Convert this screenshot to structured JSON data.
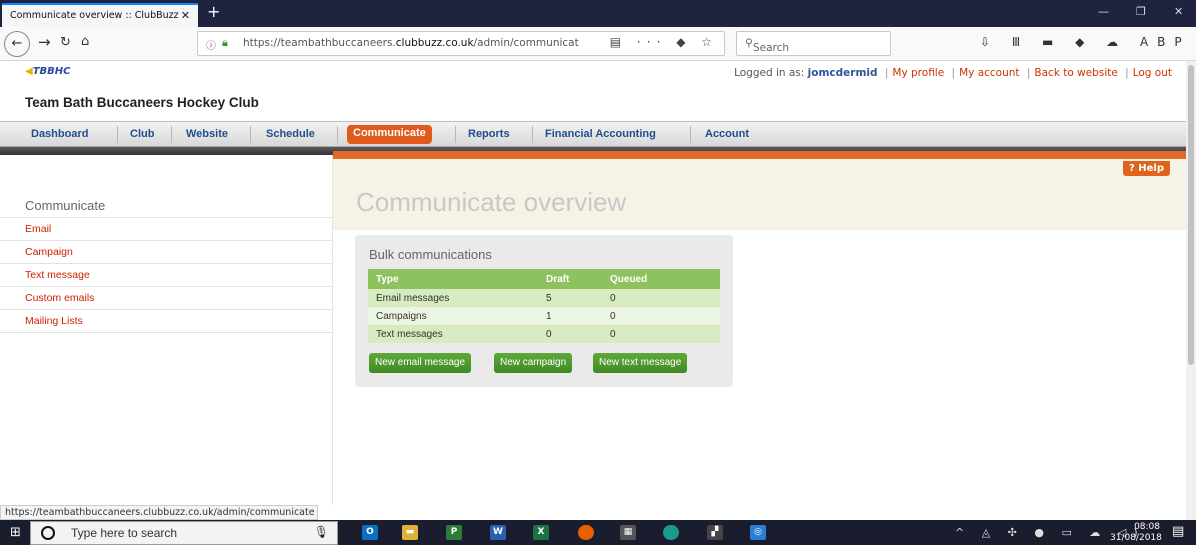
{
  "browser": {
    "tab_title": "Communicate overview :: ClubBuzz",
    "tab_close": "✕",
    "new_tab": "+",
    "url_prefix": "https://teambathbuccaneers.",
    "url_domain": "clubbuzz.co.uk",
    "url_suffix": "/admin/communicat",
    "search_placeholder": "Search",
    "url_actions": "▤ ··· ◆ ☆",
    "toolbar_icons": "⇩ Ⅲ ▬ ◆ ☁ ABP ▭ ≡"
  },
  "header": {
    "logo_text": "TBBHC",
    "logged_in_label": "Logged in as:",
    "username": "jomcdermid",
    "links": [
      "My profile",
      "My account",
      "Back to website",
      "Log out"
    ],
    "club_name": "Team Bath Buccaneers Hockey Club"
  },
  "main_nav": [
    "Dashboard",
    "Club",
    "Website",
    "Schedule",
    "Communicate",
    "Reports",
    "Financial Accounting",
    "Account"
  ],
  "sidebar": {
    "title": "Communicate",
    "items": [
      "Email",
      "Campaign",
      "Text message",
      "Custom emails",
      "Mailing Lists"
    ]
  },
  "content": {
    "page_title": "Communicate overview",
    "help_label": "? Help",
    "panel_title": "Bulk communications",
    "table": {
      "headers": [
        "Type",
        "Draft",
        "Queued"
      ],
      "rows": [
        [
          "Email messages",
          "5",
          "0"
        ],
        [
          "Campaigns",
          "1",
          "0"
        ],
        [
          "Text messages",
          "0",
          "0"
        ]
      ]
    },
    "buttons": [
      "New email message",
      "New campaign",
      "New text message"
    ]
  },
  "status_url": "https://teambathbuccaneers.clubbuzz.co.uk/admin/communicate",
  "taskbar": {
    "search_placeholder": "Type here to search",
    "time": "08:08",
    "date": "31/08/2018"
  },
  "colors": {
    "accent": "#e05a1d",
    "nav_link": "#1f4e8c",
    "link_red": "#cc2200",
    "table_green": "#8dc25f",
    "button_green": "#4a952b"
  }
}
